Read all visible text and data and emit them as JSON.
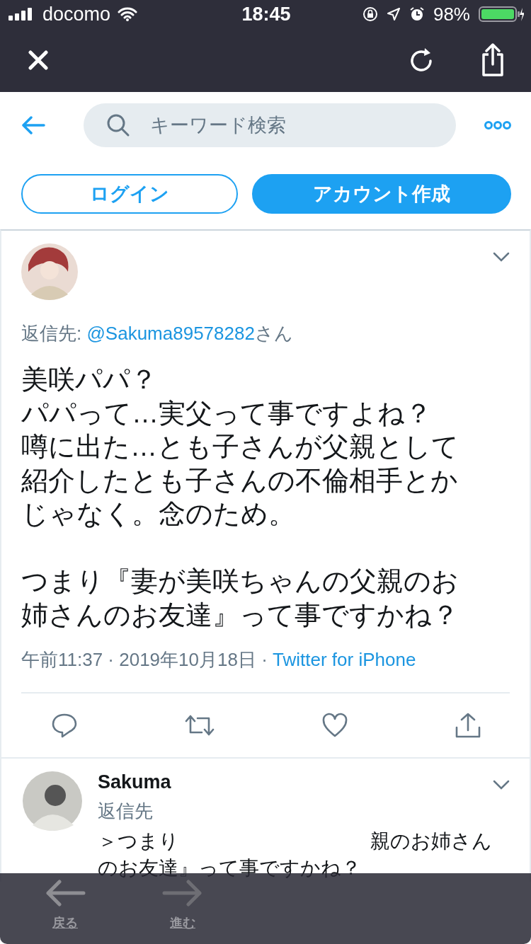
{
  "status_bar": {
    "carrier": "docomo",
    "time": "18:45",
    "battery": "98%"
  },
  "search": {
    "placeholder": "キーワード検索"
  },
  "auth_buttons": [
    {
      "label": "ログイン",
      "kind": "outline"
    },
    {
      "label": "アカウント作成",
      "kind": "filled"
    }
  ],
  "tweet": {
    "reply_prefix": "返信先: ",
    "reply_to": "@Sakuma89578282",
    "reply_suffix": "さん",
    "body": [
      [
        "美咲パパ？",
        "パパって…実父って事ですよね？",
        "噂に出た…とも子さんが父親として",
        "紹介したとも子さんの不倫相手とか",
        "じゃなく。念のため。"
      ],
      [
        "つまり『妻が美咲ちゃんの父親のお",
        "姉さんのお友達』って事ですかね？"
      ]
    ],
    "timestamp": "午前11:37 · 2019年10月18日 · ",
    "source": "Twitter for iPhone"
  },
  "reply": {
    "name": "Sakuma",
    "reply_prefix": "返信先",
    "body_start": "＞つまり",
    "body_end": "親のお姉さん",
    "body_line_2": "のお友達』って事ですかね？"
  },
  "toolbar": [
    {
      "label": "戻る",
      "kind": "back"
    },
    {
      "label": "進む",
      "kind": "forward"
    }
  ]
}
